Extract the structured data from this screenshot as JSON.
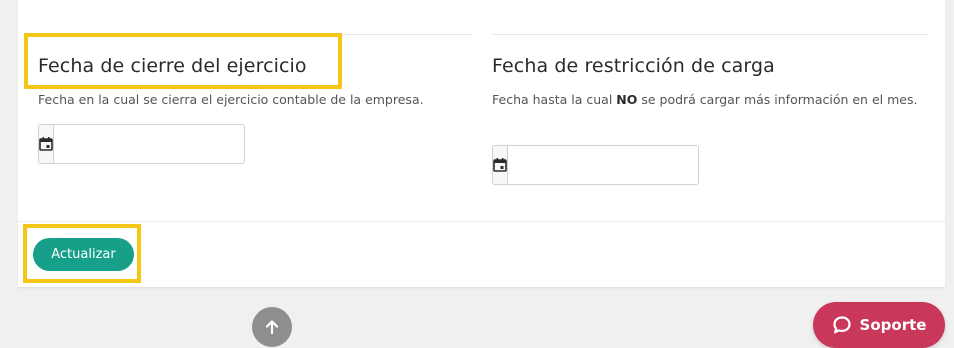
{
  "closing_date": {
    "title": "Fecha de cierre del ejercicio",
    "description": "Fecha en la cual se cierra el ejercicio contable de la empresa.",
    "value": "",
    "calendar_icon": "calendar-icon"
  },
  "restriction_date": {
    "title": "Fecha de restricción de carga",
    "description_before": "Fecha hasta la cual ",
    "description_bold": "NO",
    "description_after": " se podrá cargar más información en el mes.",
    "value": "",
    "calendar_icon": "calendar-icon"
  },
  "actions": {
    "update_label": "Actualizar"
  },
  "floating": {
    "scroll_top_icon": "arrow-up-icon",
    "support_label": "Soporte",
    "support_icon": "chat-bubble-icon"
  },
  "colors": {
    "primary": "#16a08a",
    "support": "#c9375a",
    "highlight": "#f5c518"
  }
}
